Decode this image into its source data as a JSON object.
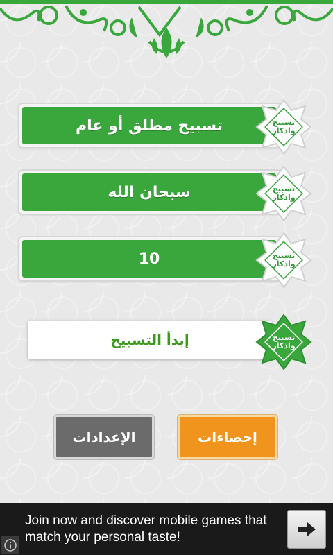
{
  "rows": [
    {
      "label": "تسبيح مطلق أو عام",
      "badge_line1": "تسبيح",
      "badge_line2": "واذكار"
    },
    {
      "label": "سبحان الله",
      "badge_line1": "تسبيح",
      "badge_line2": "واذكار"
    },
    {
      "label": "10",
      "badge_line1": "تسبيح",
      "badge_line2": "واذكار"
    }
  ],
  "start": {
    "label": "إبدأ التسبيح",
    "badge_line1": "تسبيح",
    "badge_line2": "واذكار"
  },
  "buttons": {
    "settings": "الإعدادات",
    "stats": "إحصاءات"
  },
  "ad": {
    "text": "Join now and discover mobile games that match your personal taste!"
  },
  "icons": {
    "arrow": "arrow-right-icon",
    "info": "info-icon",
    "ornament": "floral-ornament-icon"
  },
  "colors": {
    "green": "#3aa73d",
    "orange": "#f0941d",
    "gray": "#6b6b6b"
  }
}
